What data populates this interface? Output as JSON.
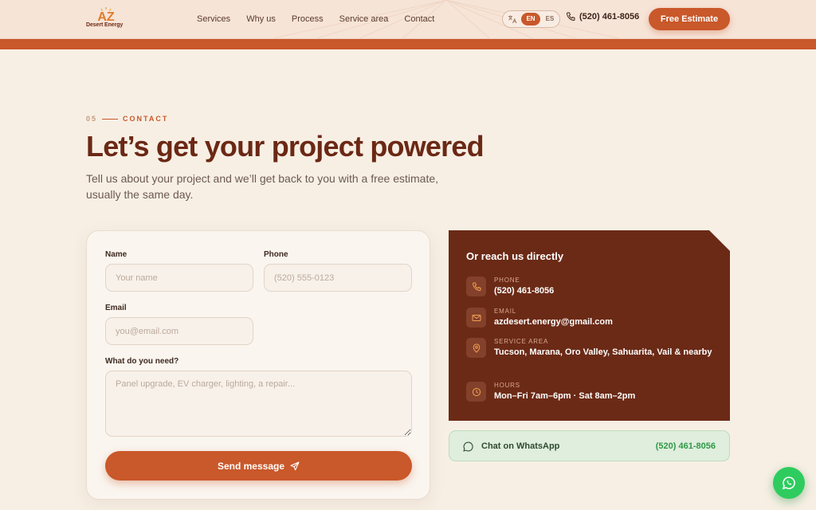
{
  "brand": {
    "mark": "AZ",
    "name": "Desert Energy"
  },
  "nav": {
    "items": [
      "Services",
      "Why us",
      "Process",
      "Service area",
      "Contact"
    ]
  },
  "lang": {
    "options": [
      "EN",
      "ES"
    ],
    "active": "EN"
  },
  "header": {
    "phone": "(520) 461-8056",
    "cta_label": "Free Estimate"
  },
  "section": {
    "number": "05",
    "label": "CONTACT",
    "title": "Let’s get your project powered",
    "subtitle": "Tell us about your project and we’ll get back to you with a free estimate, usually the same day."
  },
  "form": {
    "name_label": "Name",
    "name_placeholder": "Your name",
    "phone_label": "Phone",
    "phone_placeholder": "(520) 555-0123",
    "email_label": "Email",
    "email_placeholder": "you@email.com",
    "need_label": "What do you need?",
    "need_placeholder": "Panel upgrade, EV charger, lighting, a repair...",
    "submit_label": "Send message"
  },
  "contact": {
    "title": "Or reach us directly",
    "phone_label": "PHONE",
    "phone_value": "(520) 461-8056",
    "email_label": "EMAIL",
    "email_value": "azdesert.energy@gmail.com",
    "area_label": "SERVICE AREA",
    "area_value": "Tucson, Marana, Oro Valley, Sahuarita, Vail & nearby",
    "hours_label": "HOURS",
    "hours_value": "Mon–Fri 7am–6pm · Sat 8am–2pm"
  },
  "whatsapp": {
    "label": "Chat on WhatsApp",
    "phone": "(520) 461-8056"
  },
  "colors": {
    "accent": "#c9582a",
    "dark": "#6b2a16",
    "whatsapp": "#2ecc5f",
    "background": "#f7efe4"
  }
}
